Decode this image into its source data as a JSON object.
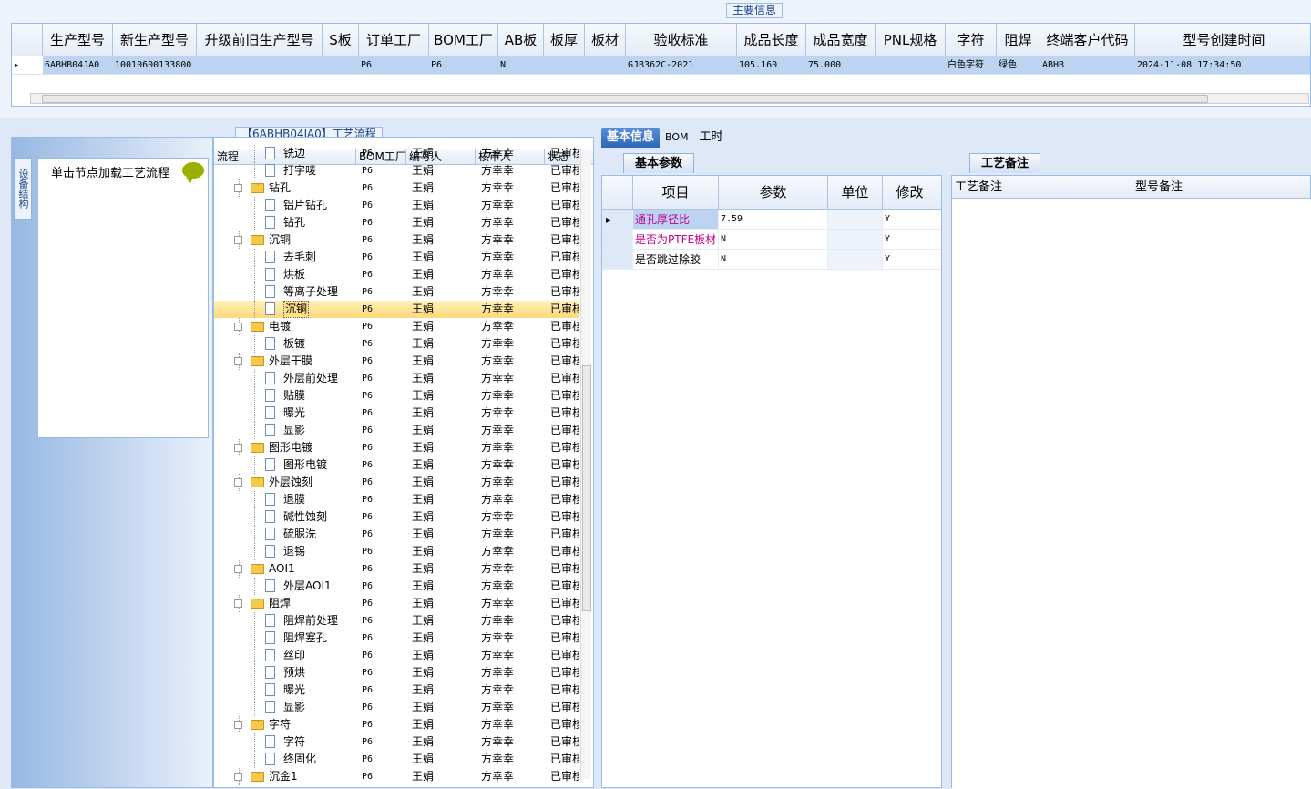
{
  "main_info": {
    "title": "主要信息",
    "columns": [
      "生产型号",
      "新生产型号",
      "升级前旧生产型号",
      "S板",
      "订单工厂",
      "BOM工厂",
      "AB板",
      "板厚",
      "板材",
      "验收标准",
      "成品长度",
      "成品宽度",
      "PNL规格",
      "字符",
      "阻焊",
      "终端客户代码",
      "型号创建时间"
    ],
    "row": [
      "6ABHB04JA0",
      "10010600133800",
      "",
      "",
      "P6",
      "P6",
      "N",
      "",
      "",
      "GJB362C-2021",
      "105.160",
      "75.000",
      "",
      "白色字符",
      "绿色",
      "ABHB",
      "2024-11-08 17:34:50"
    ]
  },
  "left_panel": {
    "vertical_tab": "设备结构",
    "hint": "单击节点加载工艺流程"
  },
  "process_tree": {
    "title": "【6ABHB04JA0】工艺流程",
    "columns": [
      "流程",
      "BOM工厂",
      "编写人",
      "核审人",
      "状态"
    ],
    "rows": [
      {
        "name": "铣边",
        "level": 2,
        "bom": "P6",
        "writer": "王娟",
        "reviewer": "方幸幸",
        "status": "已审核"
      },
      {
        "name": "打字唛",
        "level": 2,
        "bom": "P6",
        "writer": "王娟",
        "reviewer": "方幸幸",
        "status": "已审核"
      },
      {
        "name": "钻孔",
        "level": 1,
        "bom": "P6",
        "writer": "王娟",
        "reviewer": "方幸幸",
        "status": "已审核"
      },
      {
        "name": "铝片钻孔",
        "level": 2,
        "bom": "P6",
        "writer": "王娟",
        "reviewer": "方幸幸",
        "status": "已审核"
      },
      {
        "name": "钻孔",
        "level": 2,
        "bom": "P6",
        "writer": "王娟",
        "reviewer": "方幸幸",
        "status": "已审核"
      },
      {
        "name": "沉铜",
        "level": 1,
        "bom": "P6",
        "writer": "王娟",
        "reviewer": "方幸幸",
        "status": "已审核"
      },
      {
        "name": "去毛刺",
        "level": 2,
        "bom": "P6",
        "writer": "王娟",
        "reviewer": "方幸幸",
        "status": "已审核"
      },
      {
        "name": "烘板",
        "level": 2,
        "bom": "P6",
        "writer": "王娟",
        "reviewer": "方幸幸",
        "status": "已审核"
      },
      {
        "name": "等离子处理",
        "level": 2,
        "bom": "P6",
        "writer": "王娟",
        "reviewer": "方幸幸",
        "status": "已审核"
      },
      {
        "name": "沉铜",
        "level": 2,
        "bom": "P6",
        "writer": "王娟",
        "reviewer": "方幸幸",
        "status": "已审核",
        "selected": true
      },
      {
        "name": "电镀",
        "level": 1,
        "bom": "P6",
        "writer": "王娟",
        "reviewer": "方幸幸",
        "status": "已审核"
      },
      {
        "name": "板镀",
        "level": 2,
        "bom": "P6",
        "writer": "王娟",
        "reviewer": "方幸幸",
        "status": "已审核"
      },
      {
        "name": "外层干膜",
        "level": 1,
        "bom": "P6",
        "writer": "王娟",
        "reviewer": "方幸幸",
        "status": "已审核"
      },
      {
        "name": "外层前处理",
        "level": 2,
        "bom": "P6",
        "writer": "王娟",
        "reviewer": "方幸幸",
        "status": "已审核"
      },
      {
        "name": "贴膜",
        "level": 2,
        "bom": "P6",
        "writer": "王娟",
        "reviewer": "方幸幸",
        "status": "已审核"
      },
      {
        "name": "曝光",
        "level": 2,
        "bom": "P6",
        "writer": "王娟",
        "reviewer": "方幸幸",
        "status": "已审核"
      },
      {
        "name": "显影",
        "level": 2,
        "bom": "P6",
        "writer": "王娟",
        "reviewer": "方幸幸",
        "status": "已审核"
      },
      {
        "name": "图形电镀",
        "level": 1,
        "bom": "P6",
        "writer": "王娟",
        "reviewer": "方幸幸",
        "status": "已审核"
      },
      {
        "name": "图形电镀",
        "level": 2,
        "bom": "P6",
        "writer": "王娟",
        "reviewer": "方幸幸",
        "status": "已审核"
      },
      {
        "name": "外层蚀刻",
        "level": 1,
        "bom": "P6",
        "writer": "王娟",
        "reviewer": "方幸幸",
        "status": "已审核"
      },
      {
        "name": "退膜",
        "level": 2,
        "bom": "P6",
        "writer": "王娟",
        "reviewer": "方幸幸",
        "status": "已审核"
      },
      {
        "name": "碱性蚀刻",
        "level": 2,
        "bom": "P6",
        "writer": "王娟",
        "reviewer": "方幸幸",
        "status": "已审核"
      },
      {
        "name": "硫脲洗",
        "level": 2,
        "bom": "P6",
        "writer": "王娟",
        "reviewer": "方幸幸",
        "status": "已审核"
      },
      {
        "name": "退锡",
        "level": 2,
        "bom": "P6",
        "writer": "王娟",
        "reviewer": "方幸幸",
        "status": "已审核"
      },
      {
        "name": "AOI1",
        "level": 1,
        "bom": "P6",
        "writer": "王娟",
        "reviewer": "方幸幸",
        "status": "已审核"
      },
      {
        "name": "外层AOI1",
        "level": 2,
        "bom": "P6",
        "writer": "王娟",
        "reviewer": "方幸幸",
        "status": "已审核"
      },
      {
        "name": "阻焊",
        "level": 1,
        "bom": "P6",
        "writer": "王娟",
        "reviewer": "方幸幸",
        "status": "已审核"
      },
      {
        "name": "阻焊前处理",
        "level": 2,
        "bom": "P6",
        "writer": "王娟",
        "reviewer": "方幸幸",
        "status": "已审核"
      },
      {
        "name": "阻焊塞孔",
        "level": 2,
        "bom": "P6",
        "writer": "王娟",
        "reviewer": "方幸幸",
        "status": "已审核"
      },
      {
        "name": "丝印",
        "level": 2,
        "bom": "P6",
        "writer": "王娟",
        "reviewer": "方幸幸",
        "status": "已审核"
      },
      {
        "name": "预烘",
        "level": 2,
        "bom": "P6",
        "writer": "王娟",
        "reviewer": "方幸幸",
        "status": "已审核"
      },
      {
        "name": "曝光",
        "level": 2,
        "bom": "P6",
        "writer": "王娟",
        "reviewer": "方幸幸",
        "status": "已审核"
      },
      {
        "name": "显影",
        "level": 2,
        "bom": "P6",
        "writer": "王娟",
        "reviewer": "方幸幸",
        "status": "已审核"
      },
      {
        "name": "字符",
        "level": 1,
        "bom": "P6",
        "writer": "王娟",
        "reviewer": "方幸幸",
        "status": "已审核"
      },
      {
        "name": "字符",
        "level": 2,
        "bom": "P6",
        "writer": "王娟",
        "reviewer": "方幸幸",
        "status": "已审核"
      },
      {
        "name": "终固化",
        "level": 2,
        "bom": "P6",
        "writer": "王娟",
        "reviewer": "方幸幸",
        "status": "已审核"
      },
      {
        "name": "沉金1",
        "level": 1,
        "bom": "P6",
        "writer": "王娟",
        "reviewer": "方幸幸",
        "status": "已审核"
      }
    ]
  },
  "right_tabs": [
    "基本信息",
    "BOM",
    "工时"
  ],
  "basic_params": {
    "tab": "基本参数",
    "columns": [
      "项目",
      "参数",
      "单位",
      "修改"
    ],
    "rows": [
      {
        "item": "通孔厚径比",
        "value": "7.59",
        "unit": "",
        "modify": "Y",
        "highlight": true
      },
      {
        "item": "是否为PTFE板材",
        "value": "N",
        "unit": "",
        "modify": "Y",
        "highlight": true
      },
      {
        "item": "是否跳过除胶",
        "value": "N",
        "unit": "",
        "modify": "Y",
        "highlight": false
      }
    ]
  },
  "process_notes": {
    "tab": "工艺备注",
    "columns": [
      "工艺备注",
      "型号备注"
    ]
  }
}
